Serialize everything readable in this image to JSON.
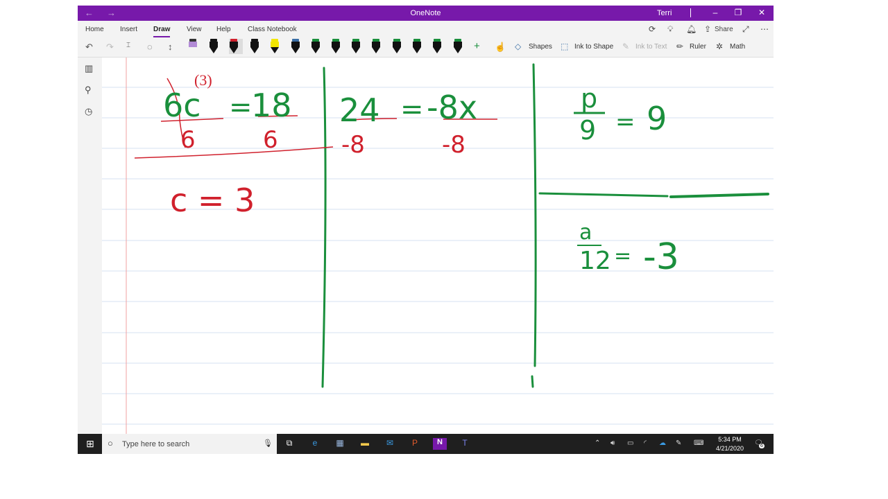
{
  "titlebar": {
    "back": "←",
    "forward": "→",
    "title": "OneNote",
    "user": "Terri",
    "minimize": "–",
    "restore": "❐",
    "close": "✕"
  },
  "ribbon": {
    "tabs": [
      "Home",
      "Insert",
      "Draw",
      "View",
      "Help",
      "Class Notebook"
    ],
    "active_tab": "Draw",
    "share_label": "Share"
  },
  "toolbar": {
    "shapes_label": "Shapes",
    "ink_to_shape_label": "Ink to Shape",
    "ink_to_text_label": "Ink to Text",
    "ruler_label": "Ruler",
    "math_label": "Math",
    "add_pen": "+"
  },
  "colors": {
    "accent": "#7719aa",
    "ink_green": "#1a8f3c",
    "ink_red": "#d0202c",
    "rule_line": "#d6e0f0",
    "margin_line": "#f0a0a0"
  },
  "taskbar": {
    "search_placeholder": "Type here to search",
    "time": "5:34 PM",
    "date": "4/21/2020",
    "notification_count": "6"
  },
  "ink": {
    "problem1": {
      "numerator_left": "6c",
      "equals": "=",
      "numerator_right": "18",
      "den_left": "6",
      "den_right": "6",
      "note": "(3)",
      "answer": "c = 3"
    },
    "problem2": {
      "left": "24",
      "right": "-8x",
      "den_left": "-8",
      "den_right": "-8"
    },
    "problem3": {
      "num": "p",
      "den": "9",
      "right": "9"
    },
    "problem4": {
      "num": "a",
      "den": "12",
      "right": "-3"
    }
  }
}
